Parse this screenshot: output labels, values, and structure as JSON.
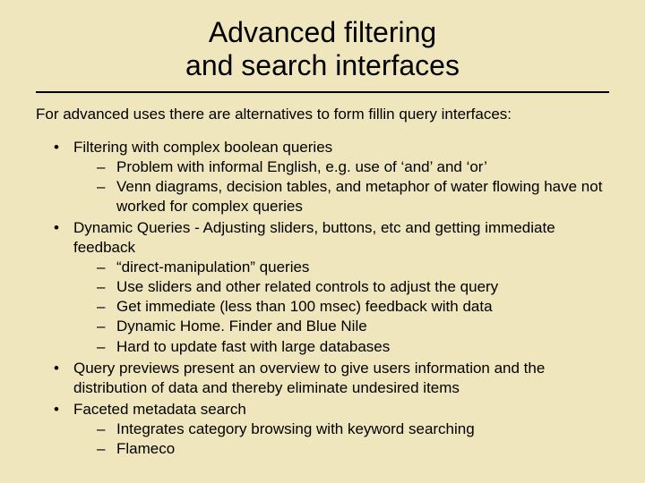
{
  "title_line1": "Advanced filtering",
  "title_line2": "and search interfaces",
  "intro": "For advanced uses there are alternatives to form fillin query interfaces:",
  "b1": "Filtering with complex boolean queries",
  "b1s1": "Problem with informal English, e.g. use of ‘and’ and ‘or’",
  "b1s2": "Venn diagrams, decision tables, and metaphor of water flowing have not worked for complex queries",
  "b2": "Dynamic Queries - Adjusting sliders, buttons, etc and getting immediate feedback",
  "b2s1": "“direct-manipulation” queries",
  "b2s2": "Use sliders and other related controls to adjust the query",
  "b2s3": "Get immediate (less than 100 msec) feedback with data",
  "b2s4": "Dynamic Home. Finder and Blue Nile",
  "b2s5": "Hard to update fast with large databases",
  "b3": "Query previews present an overview to give users information and the distribution of data and thereby eliminate undesired items",
  "b4": "Faceted metadata search",
  "b4s1": "Integrates category browsing with keyword searching",
  "b4s2": "Flameco"
}
